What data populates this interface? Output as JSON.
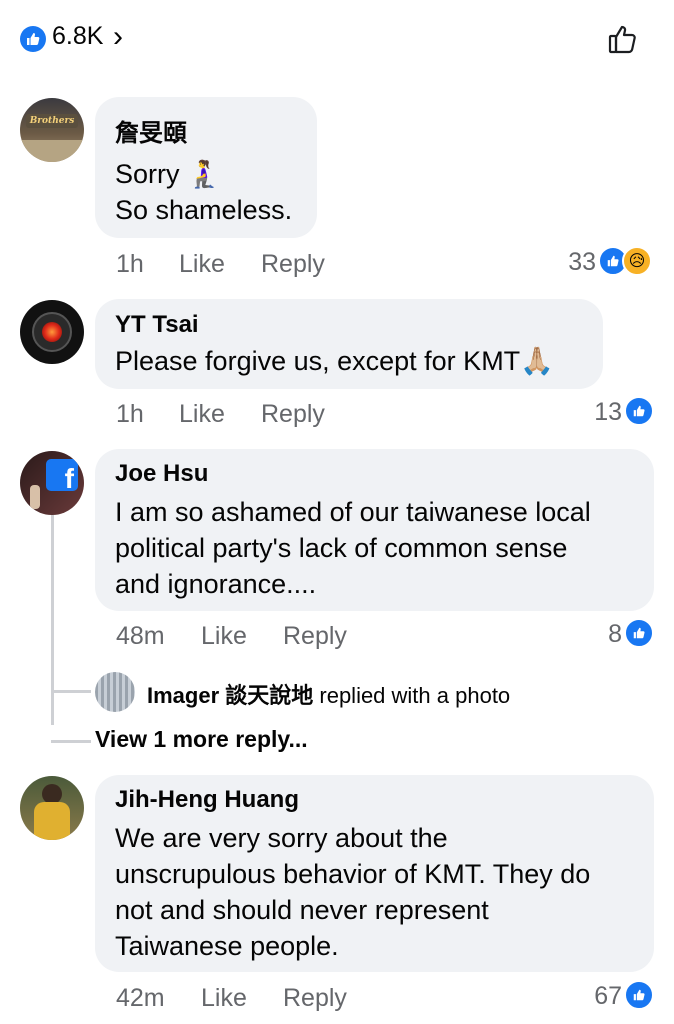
{
  "header": {
    "like_count": "6.8K",
    "chevron": "›"
  },
  "comments": [
    {
      "name": "詹旻頤",
      "lines": [
        "Sorry 🧎‍♀️",
        "So shameless."
      ],
      "time": "1h",
      "like": "Like",
      "reply": "Reply",
      "count": "33",
      "reactions": [
        "like-icon",
        "sad-icon"
      ],
      "avatar_text": "Brothers"
    },
    {
      "name": "YT Tsai",
      "lines": [
        "Please forgive us, except for KMT🙏🏼"
      ],
      "time": "1h",
      "like": "Like",
      "reply": "Reply",
      "count": "13",
      "reactions": [
        "like-icon"
      ]
    },
    {
      "name": "Joe Hsu",
      "lines": [
        "I am so ashamed of our taiwanese local",
        "political party's lack of common sense",
        "and ignorance...."
      ],
      "time": "48m",
      "like": "Like",
      "reply": "Reply",
      "count": "8",
      "reactions": [
        "like-icon"
      ]
    },
    {
      "name": "Jih-Heng Huang",
      "lines": [
        "We are very sorry about the",
        "unscrupulous behavior of KMT. They do",
        "not and should never represent",
        "Taiwanese people."
      ],
      "time": "42m",
      "like": "Like",
      "reply": "Reply",
      "count": "67",
      "reactions": [
        "like-icon"
      ]
    }
  ],
  "reply_preview": {
    "name": "Imager 談天說地",
    "action": " replied with a photo"
  },
  "view_more": "View 1 more reply...",
  "colors": {
    "accent": "#1877f2",
    "bubble": "#f0f2f5",
    "meta": "#65676b",
    "sad": "#f7b125"
  }
}
